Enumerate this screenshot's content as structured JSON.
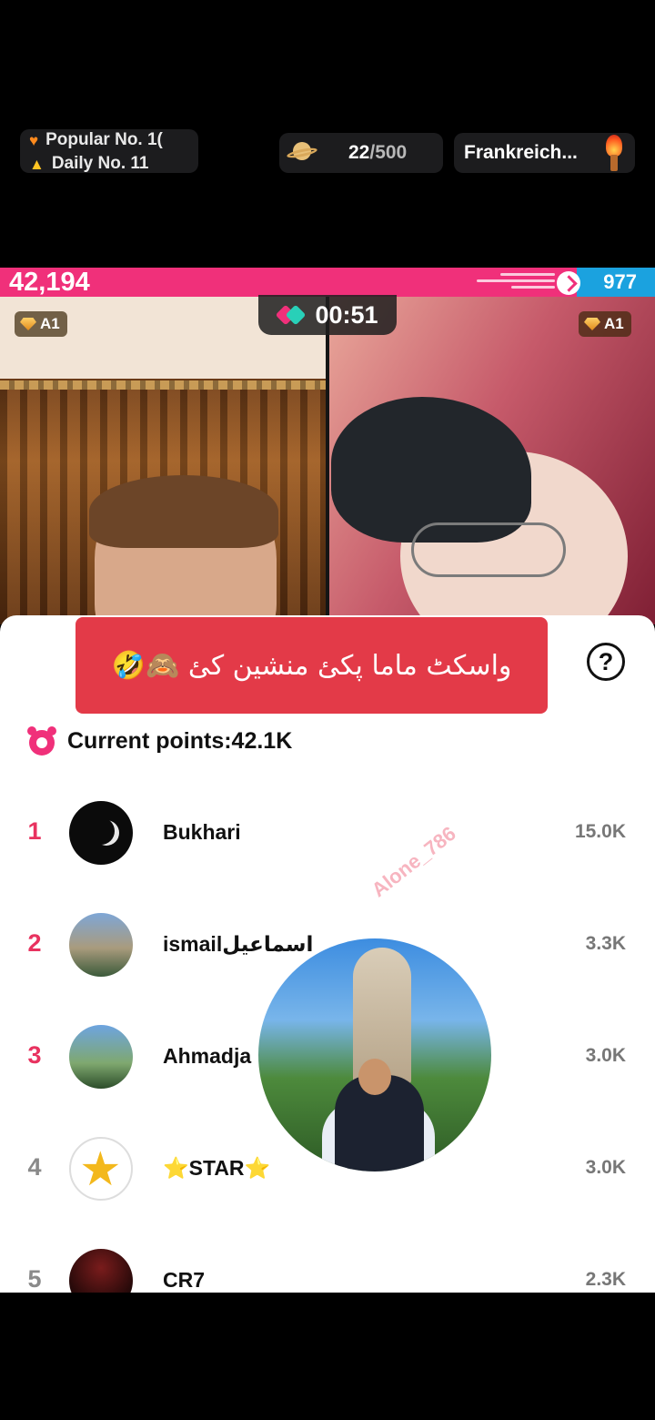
{
  "top": {
    "ranks": [
      {
        "icon": "heart-icon",
        "label": "Popular No. 1("
      },
      {
        "icon": "thumbs-up-icon",
        "label": "Daily No. 11"
      }
    ],
    "goal": {
      "current": "22",
      "separator": "/",
      "max": "500"
    },
    "location": {
      "label": "Frankreich..."
    }
  },
  "battle": {
    "left_score": "42,194",
    "right_score": "977",
    "timer": "00:51",
    "left_badge": "A1",
    "right_badge": "A1",
    "colors": {
      "left": "#f0307a",
      "right": "#1ba2df"
    }
  },
  "banner": {
    "text": "واسکٹ ماما پکئ منشین کئ 🙈🤣"
  },
  "points": {
    "label": "Current points:42.1K"
  },
  "help": {
    "symbol": "?"
  },
  "watermark": "Alone_786",
  "leaderboard": [
    {
      "rank": "1",
      "name": "Bukhari",
      "points": "15.0K",
      "avatar": "moon-avatar"
    },
    {
      "rank": "2",
      "name": "ismailاسماعیل",
      "points": "3.3K",
      "avatar": "city-avatar"
    },
    {
      "rank": "3",
      "name": "Ahmadja",
      "points": "3.0K",
      "avatar": "capitol-avatar"
    },
    {
      "rank": "4",
      "name": "⭐STAR⭐",
      "points": "3.0K",
      "avatar": "star-avatar"
    },
    {
      "rank": "5",
      "name": "CR7",
      "points": "2.3K",
      "avatar": "dark-avatar"
    }
  ]
}
